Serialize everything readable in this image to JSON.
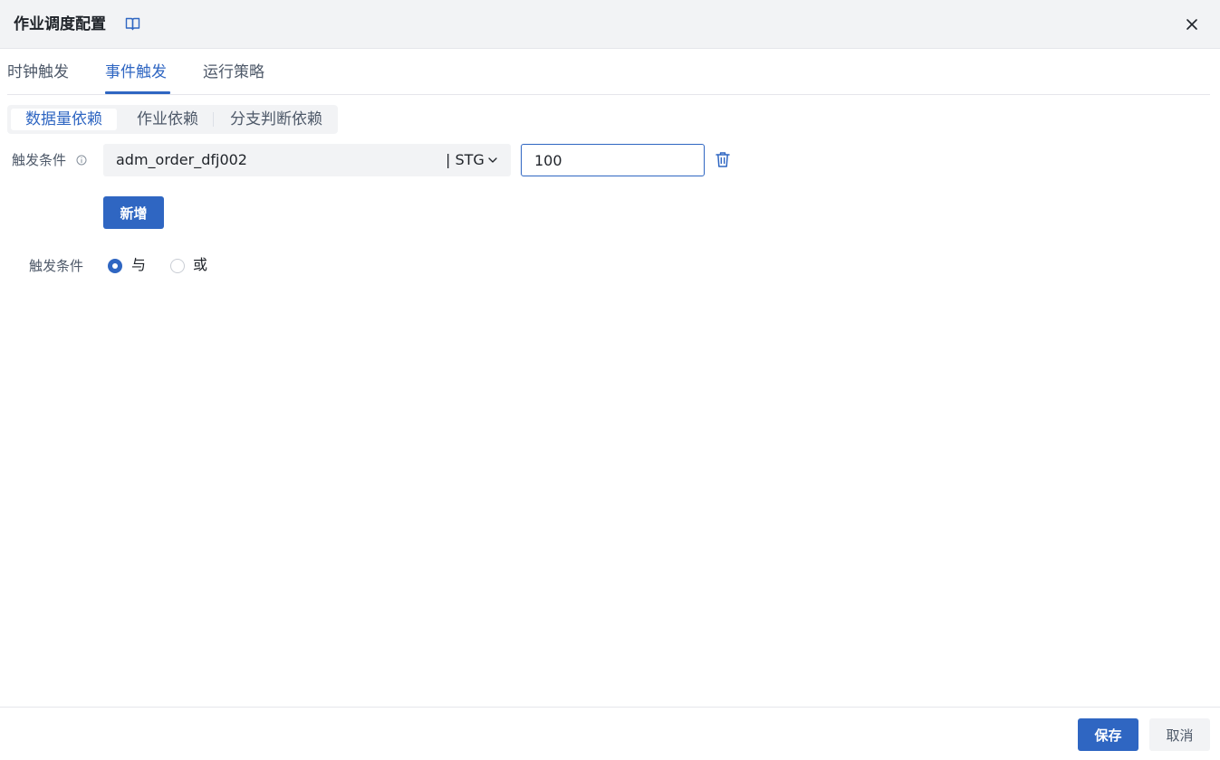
{
  "dialog": {
    "title": "作业调度配置",
    "title_icon": "book-icon",
    "close_icon": "close-icon"
  },
  "tabs": [
    {
      "label": "时钟触发",
      "active": false
    },
    {
      "label": "事件触发",
      "active": true
    },
    {
      "label": "运行策略",
      "active": false
    }
  ],
  "segments": [
    {
      "label": "数据量依赖",
      "active": true
    },
    {
      "label": "作业依赖",
      "active": false
    },
    {
      "label": "分支判断依赖",
      "active": false
    }
  ],
  "condition": {
    "label": "触发条件",
    "info_icon": "info-circle-icon",
    "table_value": "adm_order_dfj002",
    "layer_suffix": "| STG",
    "threshold_value": "100",
    "delete_icon": "trash-icon"
  },
  "add_button_label": "新增",
  "logic": {
    "label": "触发条件",
    "options": [
      {
        "label": "与",
        "checked": true
      },
      {
        "label": "或",
        "checked": false
      }
    ]
  },
  "footer": {
    "save_label": "保存",
    "cancel_label": "取消"
  },
  "colors": {
    "primary": "#2f66c2",
    "header_bg": "#f2f3f5",
    "text": "#1f2329",
    "muted": "#4e5969"
  }
}
